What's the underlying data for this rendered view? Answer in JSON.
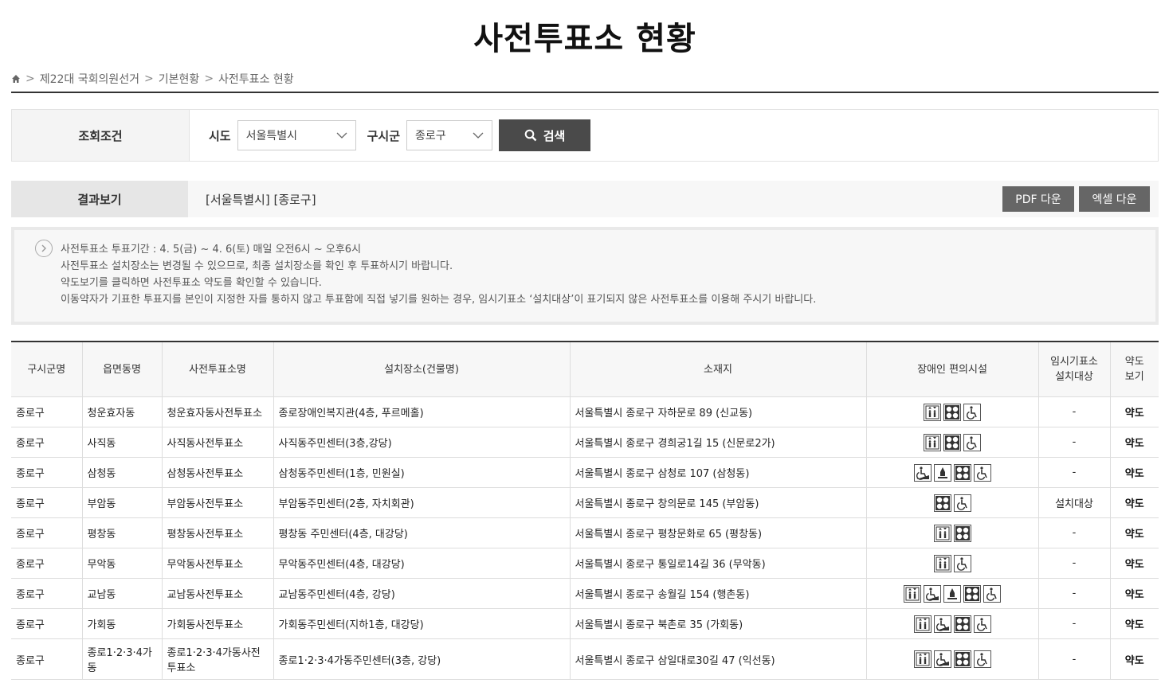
{
  "title": "사전투표소 현황",
  "breadcrumb": [
    "제22대 국회의원선거",
    "기본현황",
    "사전투표소 현황"
  ],
  "search": {
    "label": "조회조건",
    "sido_label": "시도",
    "sido_value": "서울특별시",
    "gu_label": "구시군",
    "gu_value": "종로구",
    "button": "검색"
  },
  "result": {
    "label": "결과보기",
    "text": "[서울특별시] [종로구]",
    "pdf": "PDF 다운",
    "excel": "엑셀 다운"
  },
  "notice": [
    "사전투표소 투표기간 : 4. 5(금) ~ 4. 6(토) 매일 오전6시 ~ 오후6시",
    "사전투표소 설치장소는 변경될 수 있으므로, 최종 설치장소를 확인 후 투표하시기 바랍니다.",
    "약도보기를 클릭하면 사전투표소 약도를 확인할 수 있습니다.",
    "이동약자가 기표한 투표지를 본인이 지정한 자를 통하지 않고 투표함에 직접 넣기를 원하는 경우, 임시기표소 ‘설치대상’이 표기되지 않은 사전투표소를 이용해 주시기 바랍니다."
  ],
  "table": {
    "headers": [
      "구시군명",
      "읍면동명",
      "사전투표소명",
      "설치장소(건물명)",
      "소재지",
      "장애인 편의시설",
      "임시기표소\n설치대상",
      "약도\n보기"
    ],
    "rows": [
      {
        "gu": "종로구",
        "dong": "청운효자동",
        "name": "청운효자동사전투표소",
        "place": "종로장애인복지관(4층, 푸르메홀)",
        "addr": "서울특별시 종로구 자하문로 89 (신교동)",
        "icons": [
          "elevator-icon",
          "parking-icon",
          "wheelchair-icon"
        ],
        "temp": "-",
        "map": "약도"
      },
      {
        "gu": "종로구",
        "dong": "사직동",
        "name": "사직동사전투표소",
        "place": "사직동주민센터(3층,강당)",
        "addr": "서울특별시 종로구 경희궁1길 15 (신문로2가)",
        "icons": [
          "elevator-icon",
          "parking-icon",
          "wheelchair-icon"
        ],
        "temp": "-",
        "map": "약도"
      },
      {
        "gu": "종로구",
        "dong": "삼청동",
        "name": "삼청동사전투표소",
        "place": "삼청동주민센터(1층, 민원실)",
        "addr": "서울특별시 종로구 삼청로 107 (삼청동)",
        "icons": [
          "ramp-icon",
          "guide-icon",
          "parking-icon",
          "wheelchair-icon"
        ],
        "temp": "-",
        "map": "약도"
      },
      {
        "gu": "종로구",
        "dong": "부암동",
        "name": "부암동사전투표소",
        "place": "부암동주민센터(2층, 자치회관)",
        "addr": "서울특별시 종로구 창의문로 145 (부암동)",
        "icons": [
          "parking-icon",
          "wheelchair-icon"
        ],
        "temp": "설치대상",
        "map": "약도"
      },
      {
        "gu": "종로구",
        "dong": "평창동",
        "name": "평창동사전투표소",
        "place": "평창동 주민센터(4층, 대강당)",
        "addr": "서울특별시 종로구 평창문화로 65 (평창동)",
        "icons": [
          "elevator-icon",
          "parking-icon"
        ],
        "temp": "-",
        "map": "약도"
      },
      {
        "gu": "종로구",
        "dong": "무악동",
        "name": "무악동사전투표소",
        "place": "무악동주민센터(4층, 대강당)",
        "addr": "서울특별시 종로구 통일로14길 36 (무악동)",
        "icons": [
          "elevator-icon",
          "wheelchair-icon"
        ],
        "temp": "-",
        "map": "약도"
      },
      {
        "gu": "종로구",
        "dong": "교남동",
        "name": "교남동사전투표소",
        "place": "교남동주민센터(4층, 강당)",
        "addr": "서울특별시 종로구 송월길 154 (행촌동)",
        "icons": [
          "elevator-icon",
          "ramp-icon",
          "guide-icon",
          "parking-icon",
          "wheelchair-icon"
        ],
        "temp": "-",
        "map": "약도"
      },
      {
        "gu": "종로구",
        "dong": "가회동",
        "name": "가회동사전투표소",
        "place": "가회동주민센터(지하1층, 대강당)",
        "addr": "서울특별시 종로구 북촌로 35 (가회동)",
        "icons": [
          "elevator-icon",
          "ramp-icon",
          "parking-icon",
          "wheelchair-icon"
        ],
        "temp": "-",
        "map": "약도"
      },
      {
        "gu": "종로구",
        "dong": "종로1·2·3·4가동",
        "name": "종로1·2·3·4가동사전투표소",
        "place": "종로1·2·3·4가동주민센터(3층, 강당)",
        "addr": "서울특별시 종로구 삼일대로30길 47 (익선동)",
        "icons": [
          "elevator-icon",
          "ramp-icon",
          "parking-icon",
          "wheelchair-icon"
        ],
        "temp": "-",
        "map": "약도"
      }
    ]
  }
}
